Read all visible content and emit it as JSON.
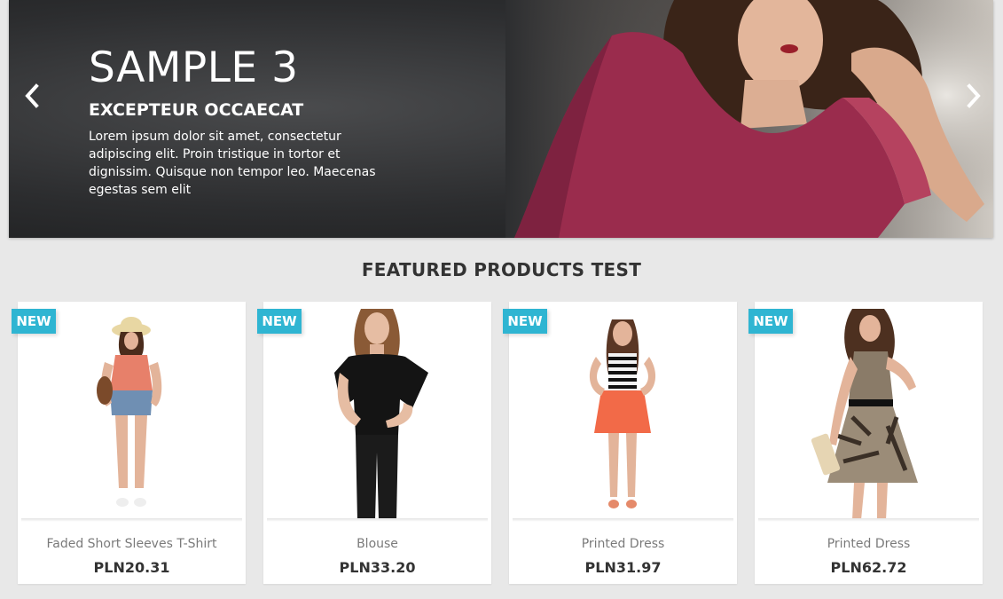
{
  "slider": {
    "title": "SAMPLE 3",
    "subtitle": "EXCEPTEUR OCCAECAT",
    "text": "Lorem ipsum dolor sit amet, consectetur adipiscing elit. Proin tristique in tortor et dignissim. Quisque non tempor leo. Maecenas egestas sem elit",
    "prev_icon": "chevron-left-icon",
    "next_icon": "chevron-right-icon"
  },
  "featured": {
    "title": "FEATURED PRODUCTS TEST",
    "badge_color": "#2fb5d2",
    "products": [
      {
        "badge": "NEW",
        "name": "Faded Short Sleeves T-Shirt",
        "price": "PLN20.31"
      },
      {
        "badge": "NEW",
        "name": "Blouse",
        "price": "PLN33.20"
      },
      {
        "badge": "NEW",
        "name": "Printed Dress",
        "price": "PLN31.97"
      },
      {
        "badge": "NEW",
        "name": "Printed Dress",
        "price": "PLN62.72"
      }
    ]
  }
}
